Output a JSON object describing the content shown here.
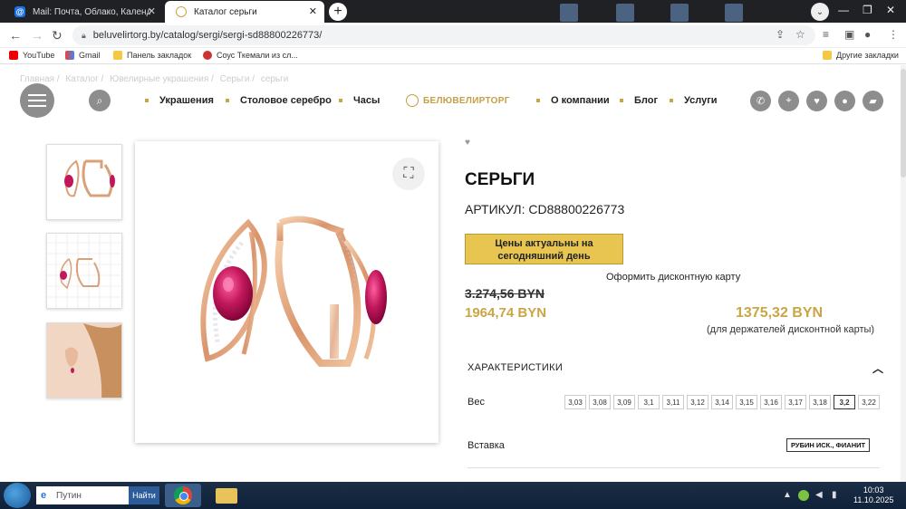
{
  "browser": {
    "tabs": [
      {
        "title": "Mail: Почта, Облако, Календарь",
        "active": false,
        "icon": "mail-icon"
      },
      {
        "title": "Каталог серьги",
        "active": true,
        "icon": "jewel-icon"
      }
    ],
    "url": "beluvelirtorg.by/catalog/sergi/sergi-sd88800226773/",
    "bookmarks": [
      "YouTube",
      "Gmail",
      "Панель закладок",
      "Соус Ткемали из сл...",
      "Другие закладки"
    ]
  },
  "site": {
    "breadcrumb": [
      "Главная /",
      "Каталог /",
      "Ювелирные украшения /",
      "Серьги /",
      "серьги"
    ],
    "nav_left": [
      "Украшения",
      "Столовое серебро",
      "Часы"
    ],
    "logo": "БЕЛЮВЕЛИРТОРГ",
    "nav_right": [
      "О компании",
      "Блог",
      "Услуги"
    ],
    "icons": [
      "phone-icon",
      "location-icon",
      "heart-icon",
      "user-icon",
      "cart-icon"
    ],
    "accent_color": "#c9a545"
  },
  "product": {
    "title": "СЕРЬГИ",
    "sku": "АРТИКУЛ: CD88800226773",
    "price_note": "Цены актуальны на сегодняшний день",
    "card_link": "Оформить дисконтную карту",
    "old_price": "3.274,56 BYN",
    "new_price": "1964,74 BYN",
    "card_price": "1375,32 BYN",
    "card_note": "(для держателей дисконтной карты)",
    "characteristics_title": "ХАРАКТЕРИСТИКИ",
    "weight_label": "Вес",
    "weights": [
      "3,03",
      "3,08",
      "3,09",
      "3,1",
      "3,11",
      "3,12",
      "3,14",
      "3,15",
      "3,16",
      "3,17",
      "3,18",
      "3,2",
      "3,22"
    ],
    "selected_weight": "3,2",
    "insert_label": "Вставка",
    "insert_value": "РУБИН ИСК., ФИАНИТ"
  },
  "taskbar": {
    "search_placeholder": "Путин",
    "search_button": "Найти",
    "time": "10:03",
    "date": "11.10.2025"
  }
}
